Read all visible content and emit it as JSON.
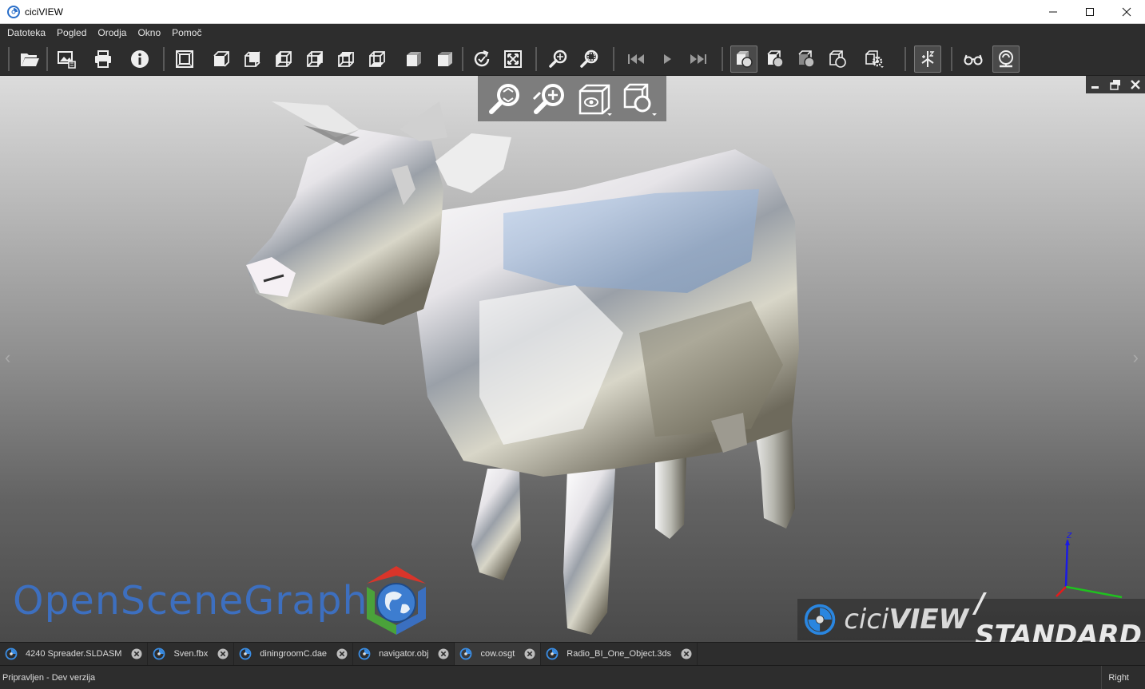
{
  "window": {
    "title": "ciciVIEW"
  },
  "menu": [
    "Datoteka",
    "Pogled",
    "Orodja",
    "Okno",
    "Pomoč"
  ],
  "toolbar": {
    "icons": [
      "open-folder-icon",
      "export-image-icon",
      "print-icon",
      "info-icon",
      "fit-view-icon",
      "view-front-icon",
      "view-back-icon",
      "view-left-icon",
      "view-right-icon",
      "view-top-icon",
      "view-bottom-icon",
      "view-iso-icon",
      "view-iso-alt-icon",
      "rotate-icon",
      "fit-all-icon",
      "zoom-icon",
      "zoom-region-icon",
      "first-frame-icon",
      "play-icon",
      "last-frame-icon",
      "shaded-icon",
      "shaded-edges-icon",
      "transparent-icon",
      "wireframe-icon",
      "display-settings-icon",
      "axis-tool-icon",
      "stereo-glasses-icon",
      "headlight-icon"
    ]
  },
  "viewport": {
    "osg_logo_text": "OpenSceneGraph",
    "brand_prefix": "cici",
    "brand_strong": "VIEW",
    "brand_edition": "/ STANDARD",
    "axis_label": "z"
  },
  "tabs": [
    {
      "label": "4240 Spreader.SLDASM",
      "active": false
    },
    {
      "label": "Sven.fbx",
      "active": false
    },
    {
      "label": "diningroomC.dae",
      "active": false
    },
    {
      "label": "navigator.obj",
      "active": false
    },
    {
      "label": "cow.osgt",
      "active": true
    },
    {
      "label": "Radio_BI_One_Object.3ds",
      "active": false
    }
  ],
  "status": {
    "left": "Pripravljen - Dev verzija",
    "right": "Right"
  }
}
